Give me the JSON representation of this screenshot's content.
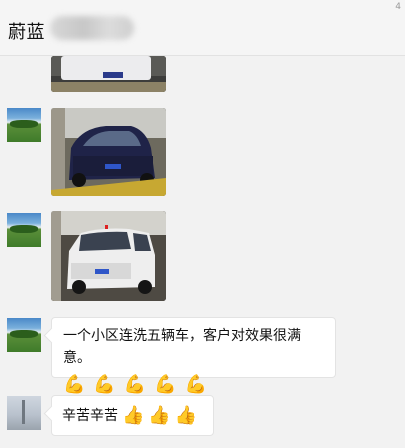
{
  "chat": {
    "title": "蔚蓝",
    "corner_mark": "4",
    "messages": [
      {
        "type": "image",
        "description": "car-photo-1"
      },
      {
        "type": "image",
        "description": "car-photo-2"
      },
      {
        "type": "image",
        "description": "car-photo-3"
      },
      {
        "type": "text",
        "text": "一个小区连洗五辆车，客户对效果很满意。",
        "emojis": [
          "💪",
          "💪",
          "💪",
          "💪",
          "💪"
        ]
      },
      {
        "type": "text",
        "text": "辛苦辛苦",
        "emojis": [
          "👍",
          "👍",
          "👍"
        ]
      }
    ]
  }
}
